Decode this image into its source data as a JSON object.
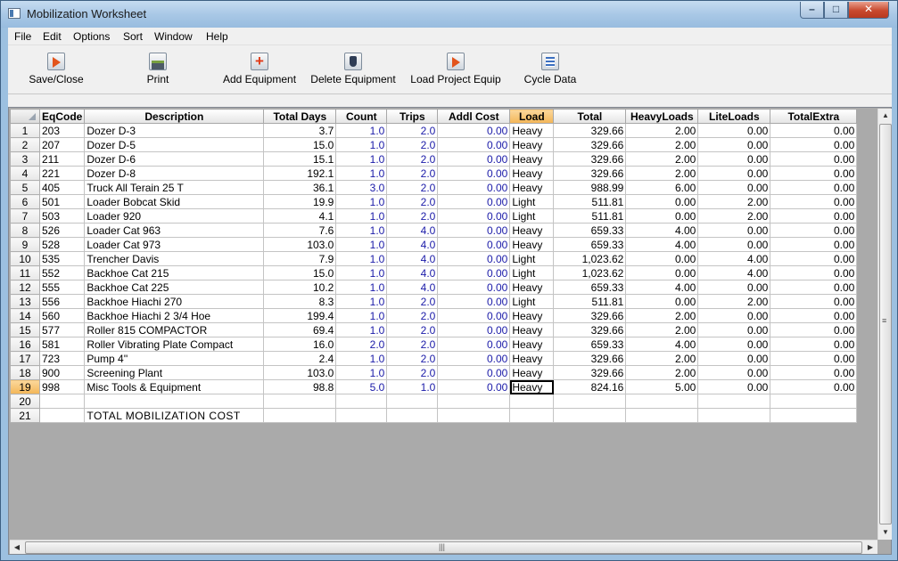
{
  "window": {
    "title": "Mobilization Worksheet"
  },
  "menu": [
    "File",
    "Edit",
    "Options",
    "Sort",
    "Window",
    "Help"
  ],
  "toolbar": {
    "save_close": "Save/Close",
    "print": "Print",
    "add_equipment": "Add Equipment",
    "delete_equipment": "Delete Equipment",
    "load_project_equip": "Load Project Equip",
    "cycle_data": "Cycle Data"
  },
  "grid": {
    "columns": [
      "EqCode",
      "Description",
      "Total Days",
      "Count",
      "Trips",
      "Addl Cost",
      "Load",
      "Total",
      "HeavyLoads",
      "LiteLoads",
      "TotalExtra"
    ],
    "active_column": "Load",
    "active_row": 19,
    "rows": [
      {
        "n": "1",
        "code": "203",
        "desc": "Dozer D-3",
        "days": "3.7",
        "count": "1.0",
        "trips": "2.0",
        "addl": "0.00",
        "load": "Heavy",
        "total": "329.66",
        "heavy": "2.00",
        "lite": "0.00",
        "extra": "0.00"
      },
      {
        "n": "2",
        "code": "207",
        "desc": "Dozer D-5",
        "days": "15.0",
        "count": "1.0",
        "trips": "2.0",
        "addl": "0.00",
        "load": "Heavy",
        "total": "329.66",
        "heavy": "2.00",
        "lite": "0.00",
        "extra": "0.00"
      },
      {
        "n": "3",
        "code": "211",
        "desc": "Dozer D-6",
        "days": "15.1",
        "count": "1.0",
        "trips": "2.0",
        "addl": "0.00",
        "load": "Heavy",
        "total": "329.66",
        "heavy": "2.00",
        "lite": "0.00",
        "extra": "0.00"
      },
      {
        "n": "4",
        "code": "221",
        "desc": "Dozer D-8",
        "days": "192.1",
        "count": "1.0",
        "trips": "2.0",
        "addl": "0.00",
        "load": "Heavy",
        "total": "329.66",
        "heavy": "2.00",
        "lite": "0.00",
        "extra": "0.00"
      },
      {
        "n": "5",
        "code": "405",
        "desc": "Truck All Terain 25 T",
        "days": "36.1",
        "count": "3.0",
        "trips": "2.0",
        "addl": "0.00",
        "load": "Heavy",
        "total": "988.99",
        "heavy": "6.00",
        "lite": "0.00",
        "extra": "0.00"
      },
      {
        "n": "6",
        "code": "501",
        "desc": "Loader Bobcat Skid",
        "days": "19.9",
        "count": "1.0",
        "trips": "2.0",
        "addl": "0.00",
        "load": "Light",
        "total": "511.81",
        "heavy": "0.00",
        "lite": "2.00",
        "extra": "0.00"
      },
      {
        "n": "7",
        "code": "503",
        "desc": "Loader 920",
        "days": "4.1",
        "count": "1.0",
        "trips": "2.0",
        "addl": "0.00",
        "load": "Light",
        "total": "511.81",
        "heavy": "0.00",
        "lite": "2.00",
        "extra": "0.00"
      },
      {
        "n": "8",
        "code": "526",
        "desc": "Loader Cat 963",
        "days": "7.6",
        "count": "1.0",
        "trips": "4.0",
        "addl": "0.00",
        "load": "Heavy",
        "total": "659.33",
        "heavy": "4.00",
        "lite": "0.00",
        "extra": "0.00"
      },
      {
        "n": "9",
        "code": "528",
        "desc": "Loader Cat 973",
        "days": "103.0",
        "count": "1.0",
        "trips": "4.0",
        "addl": "0.00",
        "load": "Heavy",
        "total": "659.33",
        "heavy": "4.00",
        "lite": "0.00",
        "extra": "0.00"
      },
      {
        "n": "10",
        "code": "535",
        "desc": "Trencher Davis",
        "days": "7.9",
        "count": "1.0",
        "trips": "4.0",
        "addl": "0.00",
        "load": "Light",
        "total": "1,023.62",
        "heavy": "0.00",
        "lite": "4.00",
        "extra": "0.00"
      },
      {
        "n": "11",
        "code": "552",
        "desc": "Backhoe Cat 215",
        "days": "15.0",
        "count": "1.0",
        "trips": "4.0",
        "addl": "0.00",
        "load": "Light",
        "total": "1,023.62",
        "heavy": "0.00",
        "lite": "4.00",
        "extra": "0.00"
      },
      {
        "n": "12",
        "code": "555",
        "desc": "Backhoe Cat 225",
        "days": "10.2",
        "count": "1.0",
        "trips": "4.0",
        "addl": "0.00",
        "load": "Heavy",
        "total": "659.33",
        "heavy": "4.00",
        "lite": "0.00",
        "extra": "0.00"
      },
      {
        "n": "13",
        "code": "556",
        "desc": "Backhoe Hiachi 270",
        "days": "8.3",
        "count": "1.0",
        "trips": "2.0",
        "addl": "0.00",
        "load": "Light",
        "total": "511.81",
        "heavy": "0.00",
        "lite": "2.00",
        "extra": "0.00"
      },
      {
        "n": "14",
        "code": "560",
        "desc": "Backhoe Hiachi 2 3/4 Hoe",
        "days": "199.4",
        "count": "1.0",
        "trips": "2.0",
        "addl": "0.00",
        "load": "Heavy",
        "total": "329.66",
        "heavy": "2.00",
        "lite": "0.00",
        "extra": "0.00"
      },
      {
        "n": "15",
        "code": "577",
        "desc": "Roller 815 COMPACTOR",
        "days": "69.4",
        "count": "1.0",
        "trips": "2.0",
        "addl": "0.00",
        "load": "Heavy",
        "total": "329.66",
        "heavy": "2.00",
        "lite": "0.00",
        "extra": "0.00"
      },
      {
        "n": "16",
        "code": "581",
        "desc": "Roller Vibrating Plate Compact",
        "days": "16.0",
        "count": "2.0",
        "trips": "2.0",
        "addl": "0.00",
        "load": "Heavy",
        "total": "659.33",
        "heavy": "4.00",
        "lite": "0.00",
        "extra": "0.00"
      },
      {
        "n": "17",
        "code": "723",
        "desc": "Pump 4''",
        "days": "2.4",
        "count": "1.0",
        "trips": "2.0",
        "addl": "0.00",
        "load": "Heavy",
        "total": "329.66",
        "heavy": "2.00",
        "lite": "0.00",
        "extra": "0.00"
      },
      {
        "n": "18",
        "code": "900",
        "desc": "Screening Plant",
        "days": "103.0",
        "count": "1.0",
        "trips": "2.0",
        "addl": "0.00",
        "load": "Heavy",
        "total": "329.66",
        "heavy": "2.00",
        "lite": "0.00",
        "extra": "0.00"
      },
      {
        "n": "19",
        "code": "998",
        "desc": "Misc Tools & Equipment",
        "days": "98.8",
        "count": "5.0",
        "trips": "1.0",
        "addl": "0.00",
        "load": "Heavy",
        "total": "824.16",
        "heavy": "5.00",
        "lite": "0.00",
        "extra": "0.00"
      },
      {
        "n": "20",
        "code": "",
        "desc": "",
        "days": "",
        "count": "",
        "trips": "",
        "addl": "",
        "load": "",
        "total": "",
        "heavy": "",
        "lite": "",
        "extra": ""
      },
      {
        "n": "21",
        "code": "",
        "desc": "TOTAL MOBILIZATION COST",
        "days": "",
        "count": "",
        "trips": "",
        "addl": "",
        "load": "",
        "total": "",
        "heavy": "",
        "lite": "",
        "extra": ""
      }
    ]
  },
  "scrollbars": {
    "vertical": "scrollbar",
    "horizontal": "scrollbar"
  }
}
